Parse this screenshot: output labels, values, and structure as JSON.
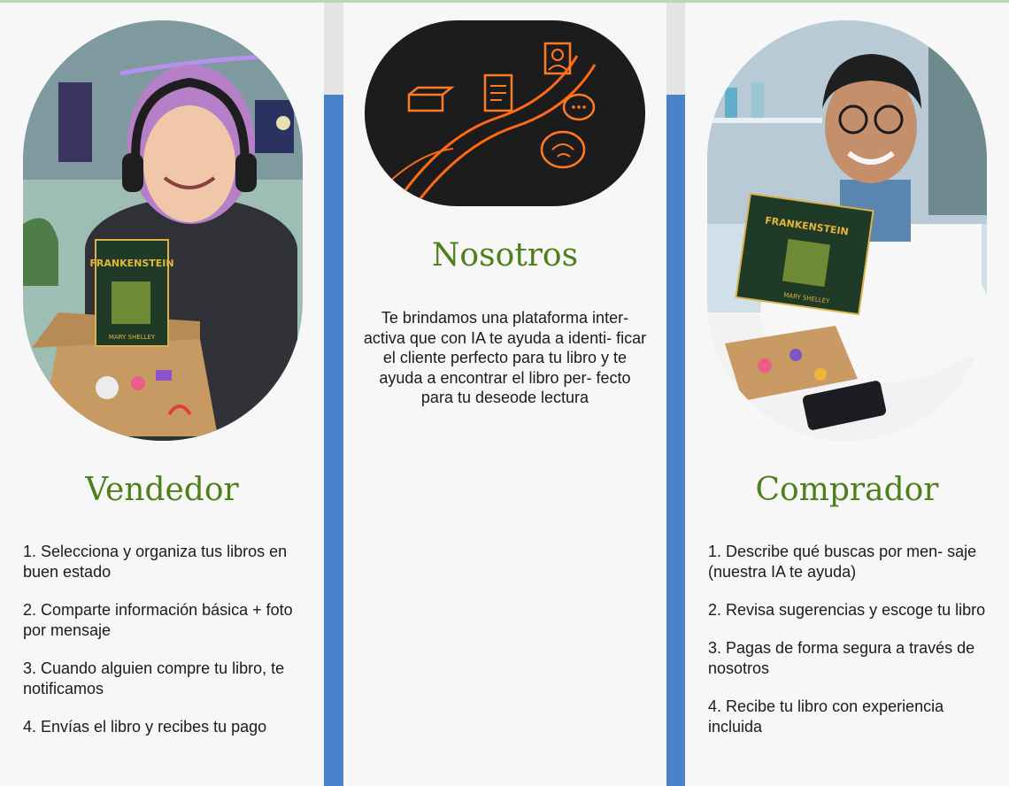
{
  "nosotros": {
    "title": "Nosotros",
    "description": "Te brindamos una plataforma inter- activa que con IA te ayuda a identi- ficar el cliente perfecto para tu libro y te ayuda a encontrar el libro per- fecto para tu deseode lectura",
    "image_icons": [
      "book-icon",
      "document-icon",
      "profile-icon",
      "chat-icon",
      "brain-icon"
    ]
  },
  "vendedor": {
    "title": "Vendedor",
    "book_title": "FRANKENSTEIN",
    "book_author": "MARY SHELLEY",
    "steps": [
      "1. Selecciona y organiza tus libros en buen estado",
      "2. Comparte información básica + foto por mensaje",
      "3. Cuando alguien compre tu libro, te notificamos",
      "4. Envías el libro y recibes tu pago"
    ]
  },
  "comprador": {
    "title": "Comprador",
    "book_title": "FRANKENSTEIN",
    "book_author": "MARY SHELLEY",
    "steps": [
      "1. Describe qué buscas por men- saje (nuestra IA te ayuda)",
      "2. Revisa sugerencias y escoge tu libro",
      "3. Pagas de forma segura a través de nosotros",
      "4. Recibe tu libro con experiencia incluida"
    ]
  },
  "colors": {
    "title_green": "#4f7f1b",
    "accent_blue": "#4a82cc",
    "card_bg": "#f7f7f7",
    "glow_orange": "#ff6a14"
  }
}
